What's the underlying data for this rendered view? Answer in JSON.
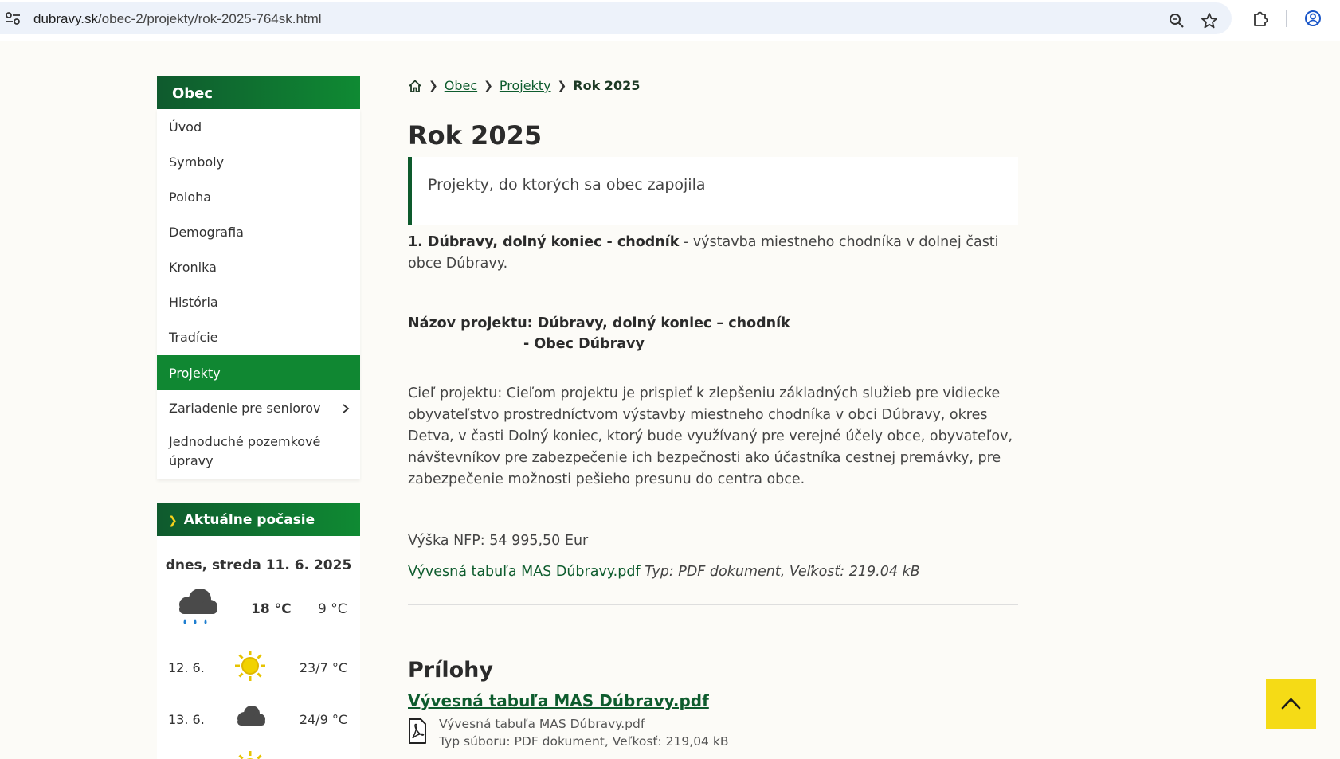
{
  "browser": {
    "url_domain": "dubravy.sk",
    "url_path": "/obec-2/projekty/rok-2025-764sk.html"
  },
  "sidebar": {
    "heading": "Obec",
    "items": [
      {
        "label": "Úvod"
      },
      {
        "label": "Symboly"
      },
      {
        "label": "Poloha"
      },
      {
        "label": "Demografia"
      },
      {
        "label": "Kronika"
      },
      {
        "label": "História"
      },
      {
        "label": "Tradície"
      },
      {
        "label": "Projekty",
        "active": true
      },
      {
        "label": "Zariadenie pre seniorov",
        "has_submenu": true
      },
      {
        "label": "Jednoduché pozemkové úpravy"
      }
    ]
  },
  "weather": {
    "heading": "Aktuálne počasie",
    "today_label": "dnes, streda 11. 6. 2025",
    "today_icon": "rain-cloud-icon",
    "today_high": "18 °C",
    "today_low": "9 °C",
    "forecast": [
      {
        "day": "12. 6.",
        "icon": "sun-icon",
        "temp": "23/7 °C"
      },
      {
        "day": "13. 6.",
        "icon": "cloud-icon",
        "temp": "24/9 °C"
      }
    ]
  },
  "breadcrumb": {
    "home_icon": "home-icon",
    "items": [
      "Obec",
      "Projekty"
    ],
    "current": "Rok 2025"
  },
  "page": {
    "title": "Rok 2025",
    "lead": "Projekty, do ktorých sa obec zapojila",
    "p1_bold": "1. Dúbravy, dolný koniec - chodník",
    "p1_rest": " - výstavba miestneho chodníka v dolnej časti obce Dúbravy.",
    "name_line1": "Názov projektu: Dúbravy, dolný koniec – chodník",
    "name_line2": "- Obec Dúbravy",
    "goal": "Cieľ projektu: Cieľom projektu je prispieť k zlepšeniu základných služieb pre vidiecke obyvateľstvo prostredníctvom výstavby miestneho chodníka v obci Dúbravy, okres Detva, v časti Dolný koniec, ktorý bude využívaný pre verejné účely obce, obyvateľov, návštevníkov pre zabezpečenie ich bezpečnosti ako účastníka cestnej premávky, pre zabezpečenie možnosti pešieho presunu do centra obce.",
    "nfp": "Výška NFP: 54 995,50 Eur",
    "file_link": "Vývesná tabuľa MAS Dúbravy.pdf",
    "file_info": "Typ: PDF dokument, Veľkosť: 219.04 kB"
  },
  "attachments": {
    "heading": "Prílohy",
    "link": "Vývesná tabuľa MAS Dúbravy.pdf",
    "name": "Vývesná tabuľa MAS Dúbravy.pdf",
    "meta": "Typ súboru: PDF dokument, Veľkosť: 219,04 kB"
  },
  "colors": {
    "brand_green": "#108732",
    "dark_green": "#0e5c2e",
    "accent_yellow": "#f5db16"
  }
}
